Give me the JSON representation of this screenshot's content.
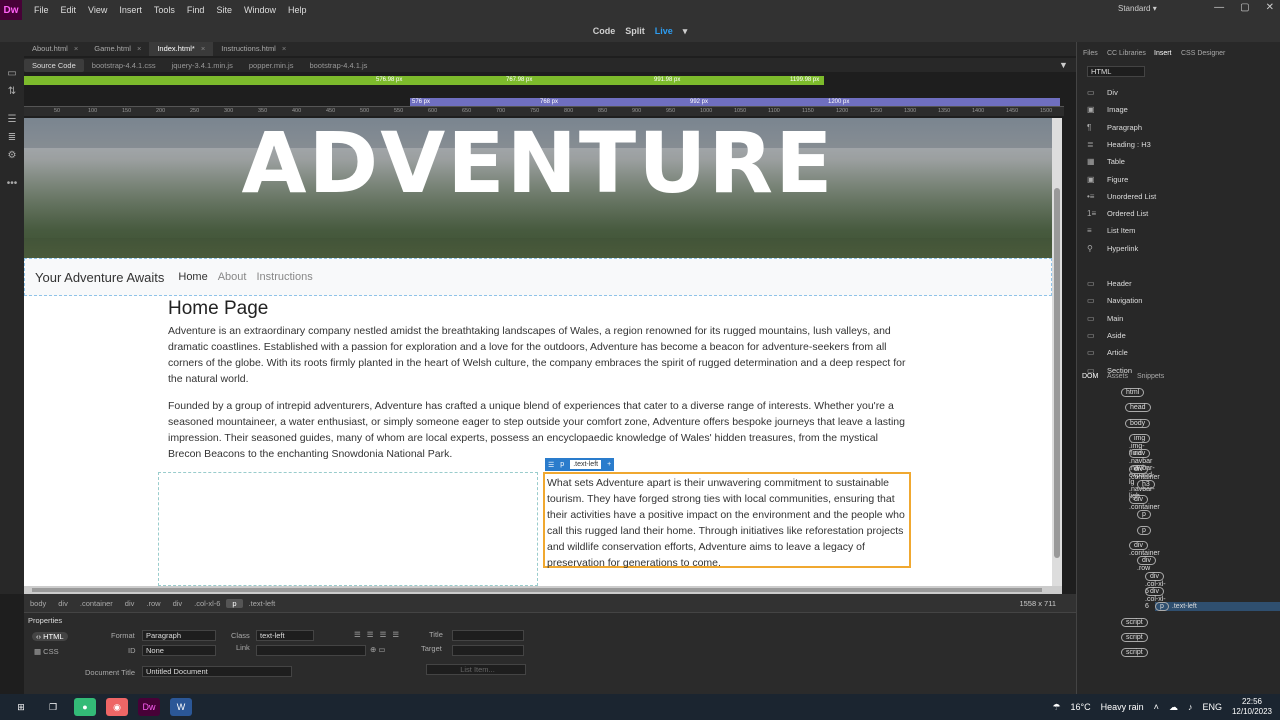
{
  "app": {
    "logo": "Dw",
    "menu": [
      "File",
      "Edit",
      "View",
      "Insert",
      "Tools",
      "Find",
      "Site",
      "Window",
      "Help"
    ],
    "workspace": "Standard"
  },
  "views": {
    "code": "Code",
    "split": "Split",
    "live": "Live"
  },
  "doc_tabs": [
    {
      "label": "About.html"
    },
    {
      "label": "Game.html"
    },
    {
      "label": "Index.html*"
    },
    {
      "label": "Instructions.html"
    }
  ],
  "related_files": [
    "Source Code",
    "bootstrap-4.4.1.css",
    "jquery-3.4.1.min.js",
    "popper.min.js",
    "bootstrap-4.4.1.js"
  ],
  "media_queries": {
    "min": [
      "576.98 px",
      "767.98 px",
      "991.98 px",
      "1199.98 px"
    ],
    "max": [
      "576 px",
      "768 px",
      "992 px",
      "1200 px"
    ]
  },
  "ruler": [
    "50",
    "100",
    "150",
    "200",
    "250",
    "300",
    "350",
    "400",
    "450",
    "500",
    "550",
    "600",
    "650",
    "700",
    "750",
    "800",
    "850",
    "900",
    "950",
    "1000",
    "1050",
    "1100",
    "1150",
    "1200",
    "1250",
    "1300",
    "1350",
    "1400",
    "1450",
    "1500"
  ],
  "page": {
    "hero_title": "ADVENTURE",
    "brand": "Your Adventure Awaits",
    "nav": [
      "Home",
      "About",
      "Instructions"
    ],
    "heading": "Home Page",
    "p1": "Adventure is an extraordinary company nestled amidst the breathtaking landscapes of Wales, a region renowned for its rugged mountains, lush valleys, and dramatic coastlines. Established with a passion for exploration and a love for the outdoors, Adventure has become a beacon for adventure-seekers from all corners of the globe. With its roots firmly planted in the heart of Welsh culture, the company embraces the spirit of rugged determination and a deep respect for the natural world.",
    "p2": "Founded by a group of intrepid adventurers, Adventure has crafted a unique blend of experiences that cater to a diverse range of interests. Whether you're a seasoned mountaineer, a water enthusiast, or simply someone eager to step outside your comfort zone, Adventure offers bespoke journeys that leave a lasting impression. Their seasoned guides, many of whom are local experts, possess an encyclopaedic knowledge of Wales' hidden treasures, from the mystical Brecon Beacons to the enchanting Snowdonia National Park.",
    "p3": "What sets Adventure apart is their unwavering commitment to sustainable tourism. They have forged strong ties with local communities, ensuring that their activities have a positive impact on the environment and the people who call this rugged land their home. Through initiatives like reforestation projects and wildlife conservation efforts, Adventure aims to leave a legacy of preservation for generations to come."
  },
  "selection": {
    "tag": "p",
    "class": ".text-left",
    "plus": "+"
  },
  "tag_selector": [
    "body",
    "div",
    ".container",
    "div",
    ".row",
    "div",
    ".col-xl-6",
    "p",
    ".text-left"
  ],
  "dimensions": "1558 x 711",
  "properties": {
    "title": "Properties",
    "html": "HTML",
    "css": "CSS",
    "format_label": "Format",
    "format": "Paragraph",
    "id_label": "ID",
    "id": "None",
    "class_label": "Class",
    "class": "text-left",
    "link_label": "Link",
    "title_label": "Title",
    "target_label": "Target",
    "doc_title_label": "Document Title",
    "doc_title": "Untitled Document",
    "list_item": "List Item..."
  },
  "right": {
    "tabs": [
      "Files",
      "CC Libraries",
      "Insert",
      "CSS Designer"
    ],
    "category": "HTML",
    "insert": [
      "Div",
      "Image",
      "Paragraph",
      "Heading : H3",
      "Table",
      "Figure",
      "Unordered List",
      "Ordered List",
      "List Item",
      "Hyperlink",
      "Header",
      "Navigation",
      "Main",
      "Aside",
      "Article",
      "Section"
    ],
    "dom_tabs": [
      "DOM",
      "Assets",
      "Snippets"
    ],
    "dom": [
      {
        "tag": "html",
        "cls": ""
      },
      {
        "tag": "head",
        "cls": ""
      },
      {
        "tag": "body",
        "cls": ""
      },
      {
        "tag": "img",
        "cls": ".img-fluid"
      },
      {
        "tag": "nav",
        "cls": ".navbar .navbar-expand-lg .navbar-ligh"
      },
      {
        "tag": "div",
        "cls": ".container"
      },
      {
        "tag": "h3",
        "cls": ""
      },
      {
        "tag": "div",
        "cls": ".container"
      },
      {
        "tag": "p",
        "cls": ""
      },
      {
        "tag": "p",
        "cls": ""
      },
      {
        "tag": "div",
        "cls": ".container"
      },
      {
        "tag": "div",
        "cls": ".row"
      },
      {
        "tag": "div",
        "cls": ".col-xl-6"
      },
      {
        "tag": "div",
        "cls": ".col-xl-6"
      },
      {
        "tag": "p",
        "cls": ".text-left"
      },
      {
        "tag": "script",
        "cls": ""
      },
      {
        "tag": "script",
        "cls": ""
      },
      {
        "tag": "script",
        "cls": ""
      }
    ]
  },
  "taskbar": {
    "weather": "16°C",
    "condition": "Heavy rain",
    "lang": "ENG",
    "time": "22:56",
    "date": "12/10/2023"
  }
}
